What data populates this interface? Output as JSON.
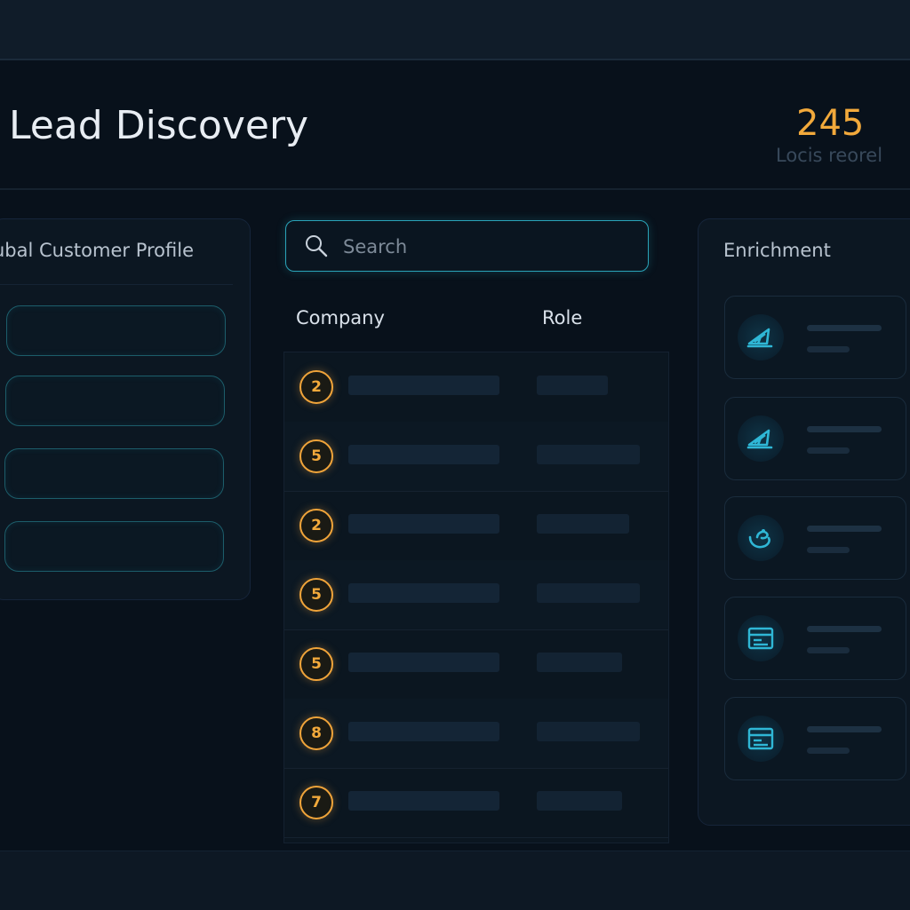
{
  "header": {
    "title": "Lead Discovery",
    "stat_value": "245",
    "stat_label": "Locis reorel"
  },
  "left_panel": {
    "title": "ubal Customer Profile",
    "fields": [
      "",
      "",
      "",
      ""
    ]
  },
  "search": {
    "placeholder": "Search",
    "value": ""
  },
  "table": {
    "columns": [
      "Company",
      "Role"
    ],
    "rows": [
      {
        "rank": "2"
      },
      {
        "rank": "5"
      },
      {
        "rank": "2"
      },
      {
        "rank": "5"
      },
      {
        "rank": "5"
      },
      {
        "rank": "8"
      },
      {
        "rank": "7"
      }
    ]
  },
  "right_panel": {
    "title": "Enrichment",
    "cards": [
      {
        "icon": "sailboat-icon"
      },
      {
        "icon": "sailboat-icon"
      },
      {
        "icon": "handshake-icon"
      },
      {
        "icon": "id-card-icon"
      },
      {
        "icon": "id-card-icon"
      }
    ]
  },
  "colors": {
    "accent_orange": "#f2a93b",
    "accent_cyan": "#2aa3b8",
    "background": "#08111b"
  }
}
